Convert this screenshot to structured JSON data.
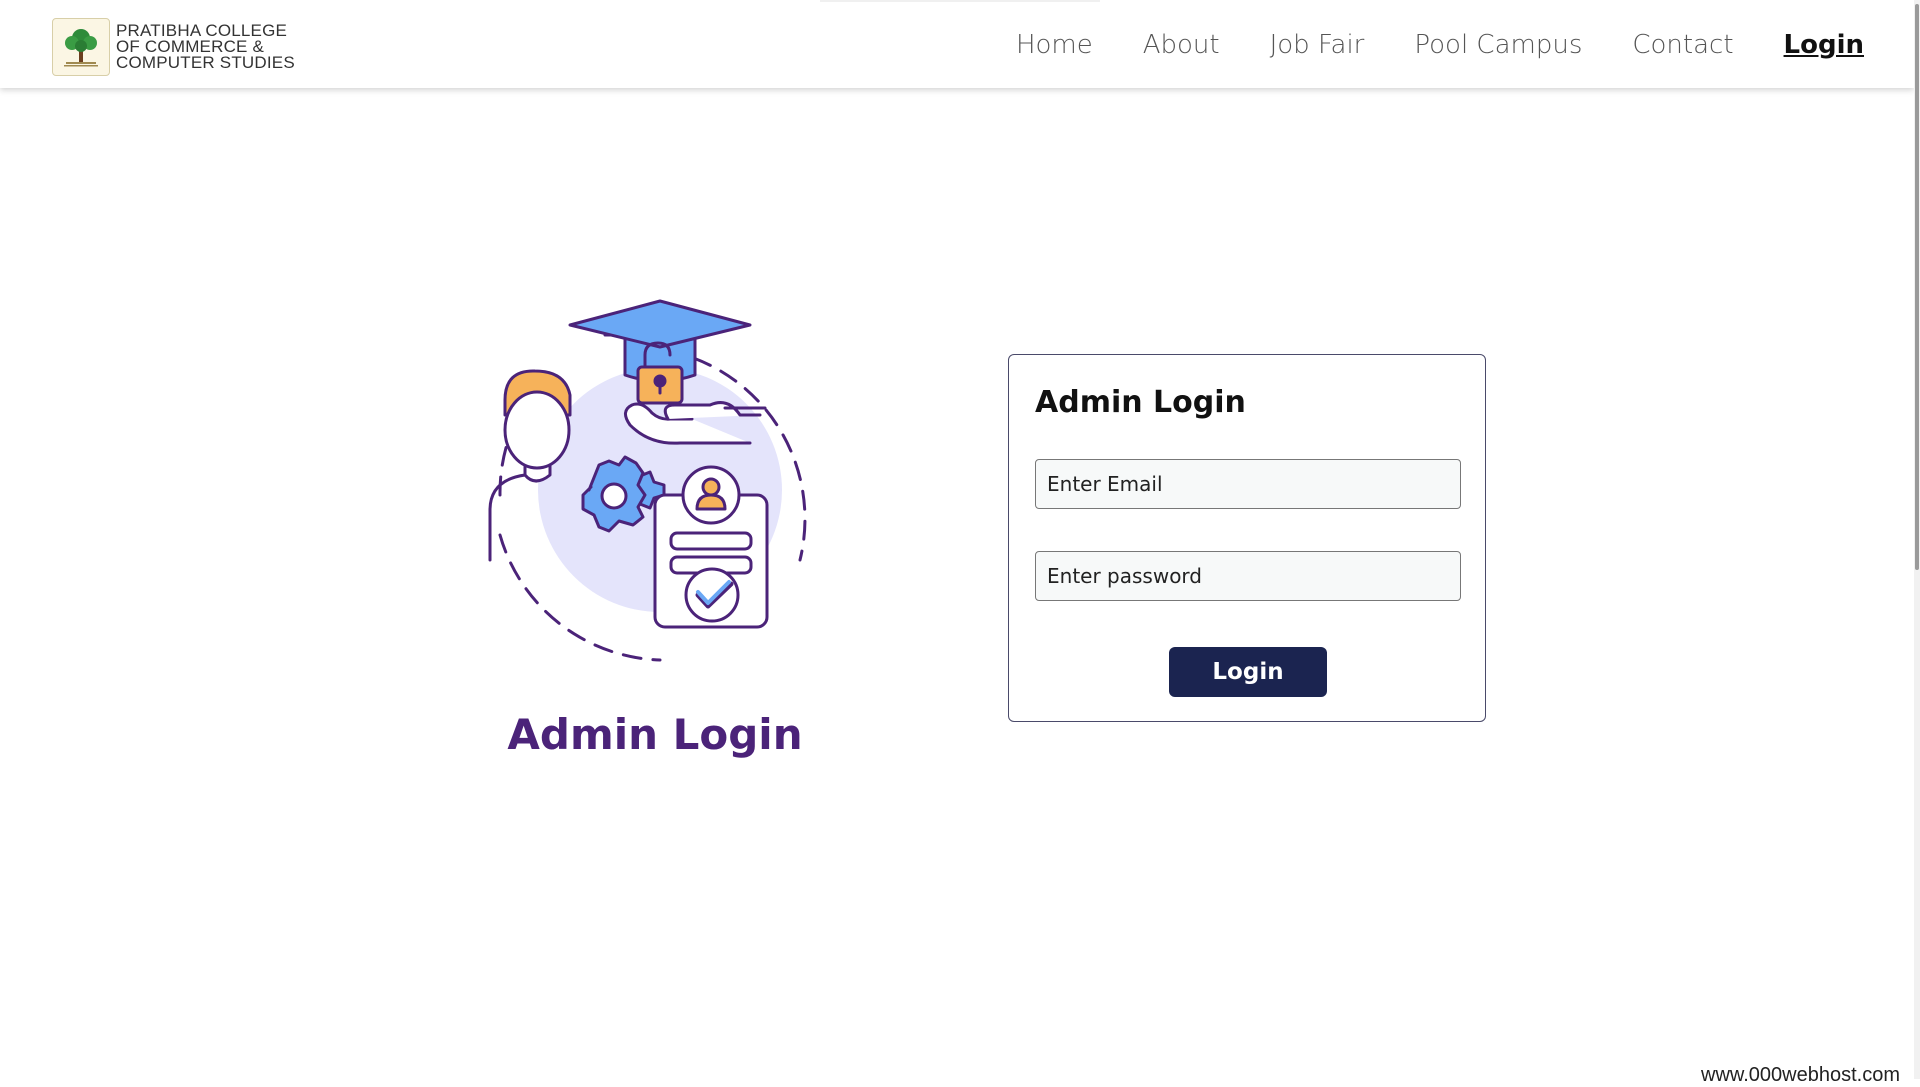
{
  "header": {
    "brand_lines": [
      "PRATIBHA COLLEGE",
      "OF COMMERCE &",
      "COMPUTER STUDIES"
    ],
    "nav": [
      {
        "label": "Home",
        "active": false
      },
      {
        "label": "About",
        "active": false
      },
      {
        "label": "Job Fair",
        "active": false
      },
      {
        "label": "Pool Campus",
        "active": false
      },
      {
        "label": "Contact",
        "active": false
      },
      {
        "label": "Login",
        "active": true
      }
    ]
  },
  "illustration": {
    "caption": "Admin Login",
    "icons": [
      "person-icon",
      "graduation-cap-icon",
      "padlock-icon",
      "hand-icon",
      "gear-icon",
      "id-card-icon",
      "checkmark-icon"
    ],
    "colors": {
      "primary": "#4b2379",
      "accent_blue": "#6aa8f5",
      "accent_orange": "#f6b25a",
      "background_circle": "#e4e4fb"
    }
  },
  "login_form": {
    "title": "Admin Login",
    "email_placeholder": "Enter Email",
    "password_placeholder": "Enter password",
    "submit_label": "Login",
    "button_color": "#1b2450"
  },
  "footer": {
    "host_text": "www.000webhost.com"
  }
}
